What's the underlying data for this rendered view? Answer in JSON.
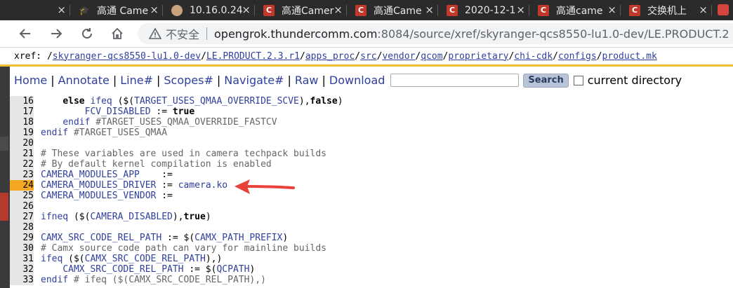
{
  "tabs": [
    {
      "title": "",
      "favicon": "generic-icon"
    },
    {
      "title": "高通 Came",
      "favicon": "graduation-cap-icon"
    },
    {
      "title": "10.16.0.24",
      "favicon": "avatar-icon"
    },
    {
      "title": "高通Camer",
      "favicon": "c-icon"
    },
    {
      "title": "高通Came",
      "favicon": "c-icon"
    },
    {
      "title": "2020-12-1",
      "favicon": "c-icon"
    },
    {
      "title": "高通came",
      "favicon": "c-icon"
    },
    {
      "title": "交换机上",
      "favicon": "c-icon"
    }
  ],
  "address": {
    "insecure_label": "不安全",
    "url_host": "opengrok.thundercomm.com",
    "url_rest": ":8084/source/xref/skyranger-qcs8550-lu1.0-dev/LE.PRODUCT.2"
  },
  "xref": {
    "prefix": "xref: /",
    "segments": [
      "skyranger-qcs8550-lu1.0-dev",
      "LE.PRODUCT.2.3.r1",
      "apps_proc",
      "src",
      "vendor",
      "qcom",
      "proprietary",
      "chi-cdk",
      "configs",
      "product.mk"
    ]
  },
  "menu": {
    "home": "Home",
    "annotate": "Annotate",
    "line": "Line#",
    "scopes": "Scopes#",
    "navigate": "Navigate#",
    "raw": "Raw",
    "download": "Download",
    "search_button": "Search",
    "current_directory": "current directory"
  },
  "code_lines": [
    {
      "num": "16",
      "parts": [
        {
          "t": "    "
        },
        {
          "t": "else",
          "c": "kw"
        },
        {
          "t": " "
        },
        {
          "t": "ifeq",
          "c": "ref"
        },
        {
          "t": " ($("
        },
        {
          "t": "TARGET_USES_QMAA_OVERRIDE_SCVE",
          "c": "ref"
        },
        {
          "t": "),"
        },
        {
          "t": "false",
          "c": "kw"
        },
        {
          "t": ")"
        }
      ]
    },
    {
      "num": "17",
      "parts": [
        {
          "t": "        "
        },
        {
          "t": "FCV_DISABLED",
          "c": "ref"
        },
        {
          "t": " := "
        },
        {
          "t": "true",
          "c": "kw"
        }
      ]
    },
    {
      "num": "18",
      "parts": [
        {
          "t": "    "
        },
        {
          "t": "endif",
          "c": "ref"
        },
        {
          "t": " #TARGET_USES_QMAA_OVERRIDE_FASTCV",
          "c": "cmt"
        }
      ]
    },
    {
      "num": "19",
      "parts": [
        {
          "t": "endif",
          "c": "ref"
        },
        {
          "t": " #TARGET_USES_QMAA",
          "c": "cmt"
        }
      ]
    },
    {
      "num": "20",
      "parts": []
    },
    {
      "num": "21",
      "parts": [
        {
          "t": "# These variables are used in camera techpack builds",
          "c": "cmt"
        }
      ]
    },
    {
      "num": "22",
      "parts": [
        {
          "t": "# By default kernel compilation is enabled",
          "c": "cmt"
        }
      ]
    },
    {
      "num": "23",
      "parts": [
        {
          "t": "CAMERA_MODULES_APP",
          "c": "ref"
        },
        {
          "t": "    :="
        }
      ]
    },
    {
      "num": "24",
      "hl": true,
      "parts": [
        {
          "t": "CAMERA_MODULES_DRIVER",
          "c": "ref"
        },
        {
          "t": " := "
        },
        {
          "t": "camera.ko",
          "c": "ref"
        }
      ]
    },
    {
      "num": "25",
      "parts": [
        {
          "t": "CAMERA_MODULES_VENDOR",
          "c": "ref"
        },
        {
          "t": " :="
        }
      ]
    },
    {
      "num": "26",
      "parts": []
    },
    {
      "num": "27",
      "parts": [
        {
          "t": "ifneq",
          "c": "ref"
        },
        {
          "t": " ($("
        },
        {
          "t": "CAMERA_DISABLED",
          "c": "ref"
        },
        {
          "t": "),"
        },
        {
          "t": "true",
          "c": "kw"
        },
        {
          "t": ")"
        }
      ]
    },
    {
      "num": "28",
      "parts": []
    },
    {
      "num": "29",
      "parts": [
        {
          "t": "CAMX_SRC_CODE_REL_PATH",
          "c": "ref"
        },
        {
          "t": " := $("
        },
        {
          "t": "CAMX_PATH_PREFIX",
          "c": "ref"
        },
        {
          "t": ")"
        }
      ]
    },
    {
      "num": "30",
      "parts": [
        {
          "t": "# Camx source code path can vary for mainline builds",
          "c": "cmt"
        }
      ]
    },
    {
      "num": "31",
      "parts": [
        {
          "t": "ifeq",
          "c": "ref"
        },
        {
          "t": " ($("
        },
        {
          "t": "CAMX_SRC_CODE_REL_PATH",
          "c": "ref"
        },
        {
          "t": "),)"
        }
      ]
    },
    {
      "num": "32",
      "parts": [
        {
          "t": "    "
        },
        {
          "t": "CAMX_SRC_CODE_REL_PATH",
          "c": "ref"
        },
        {
          "t": " := $("
        },
        {
          "t": "QCPATH",
          "c": "ref"
        },
        {
          "t": ")"
        }
      ]
    },
    {
      "num": "33",
      "parts": [
        {
          "t": "endif",
          "c": "ref"
        },
        {
          "t": " # ifeq ($(CAMX_SRC_CODE_REL_PATH),)",
          "c": "cmt"
        }
      ]
    }
  ],
  "colors": {
    "accent_bar": "#f0bd33",
    "highlight_line": "#f5a623",
    "link": "#2f3f9c",
    "annotation_arrow": "#e8413a"
  }
}
